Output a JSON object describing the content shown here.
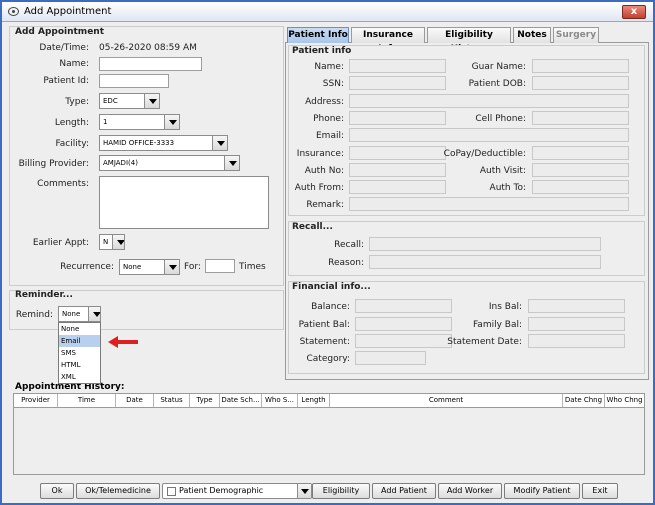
{
  "window": {
    "title": "Add Appointment",
    "close_label": "x"
  },
  "add_appointment": {
    "title": "Add Appointment",
    "datetime_label": "Date/Time:",
    "datetime_value": "05-26-2020 08:59 AM",
    "name_label": "Name:",
    "patient_id_label": "Patient Id:",
    "type_label": "Type:",
    "type_value": "EDC",
    "length_label": "Length:",
    "length_value": "1",
    "facility_label": "Facility:",
    "facility_value": "HAMID OFFICE-3333",
    "billing_provider_label": "Billing Provider:",
    "billing_provider_value": "AMJADI(4)",
    "comments_label": "Comments:",
    "earlier_appt_label": "Earlier Appt:",
    "earlier_appt_value": "N",
    "recurrence_label": "Recurrence:",
    "recurrence_value": "None",
    "for_label": "For:",
    "times_label": "Times"
  },
  "reminder": {
    "title": "Reminder...",
    "remind_label": "Remind:",
    "remind_value": "None",
    "options": [
      "None",
      "Email",
      "SMS",
      "HTML",
      "XML"
    ]
  },
  "tabs": [
    {
      "label": "Patient Info"
    },
    {
      "label": "Insurance Info"
    },
    {
      "label": "Eligibility History"
    },
    {
      "label": "Notes"
    },
    {
      "label": "Surgery"
    }
  ],
  "patient_info": {
    "title": "Patient info",
    "name_label": "Name:",
    "guar_name_label": "Guar Name:",
    "ssn_label": "SSN:",
    "dob_label": "Patient DOB:",
    "address_label": "Address:",
    "phone_label": "Phone:",
    "cell_label": "Cell Phone:",
    "email_label": "Email:",
    "insurance_label": "Insurance:",
    "copay_label": "CoPay/Deductible:",
    "auth_no_label": "Auth No:",
    "auth_visit_label": "Auth Visit:",
    "auth_from_label": "Auth From:",
    "auth_to_label": "Auth To:",
    "remark_label": "Remark:"
  },
  "recall": {
    "title": "Recall...",
    "recall_label": "Recall:",
    "reason_label": "Reason:"
  },
  "financial": {
    "title": "Financial info...",
    "balance_label": "Balance:",
    "ins_bal_label": "Ins Bal:",
    "patient_bal_label": "Patient Bal:",
    "family_bal_label": "Family Bal:",
    "statement_label": "Statement:",
    "statement_date_label": "Statement Date:",
    "category_label": "Category:"
  },
  "history": {
    "title": "Appointment History:",
    "columns": [
      "Provider",
      "Time",
      "Date",
      "Status",
      "Type",
      "Date Sch...",
      "Who S...",
      "Length",
      "Comment",
      "Date Chng",
      "Who Chng"
    ]
  },
  "buttons": {
    "ok": "Ok",
    "ok_tele": "Ok/Telemedicine",
    "patient_demographic": "Patient Demographic",
    "eligibility": "Eligibility",
    "add_patient": "Add Patient",
    "add_worker": "Add Worker",
    "modify_patient": "Modify Patient",
    "exit": "Exit"
  },
  "colors": {
    "accent_tab": "#a8c6ee",
    "arrow": "#e02020"
  }
}
